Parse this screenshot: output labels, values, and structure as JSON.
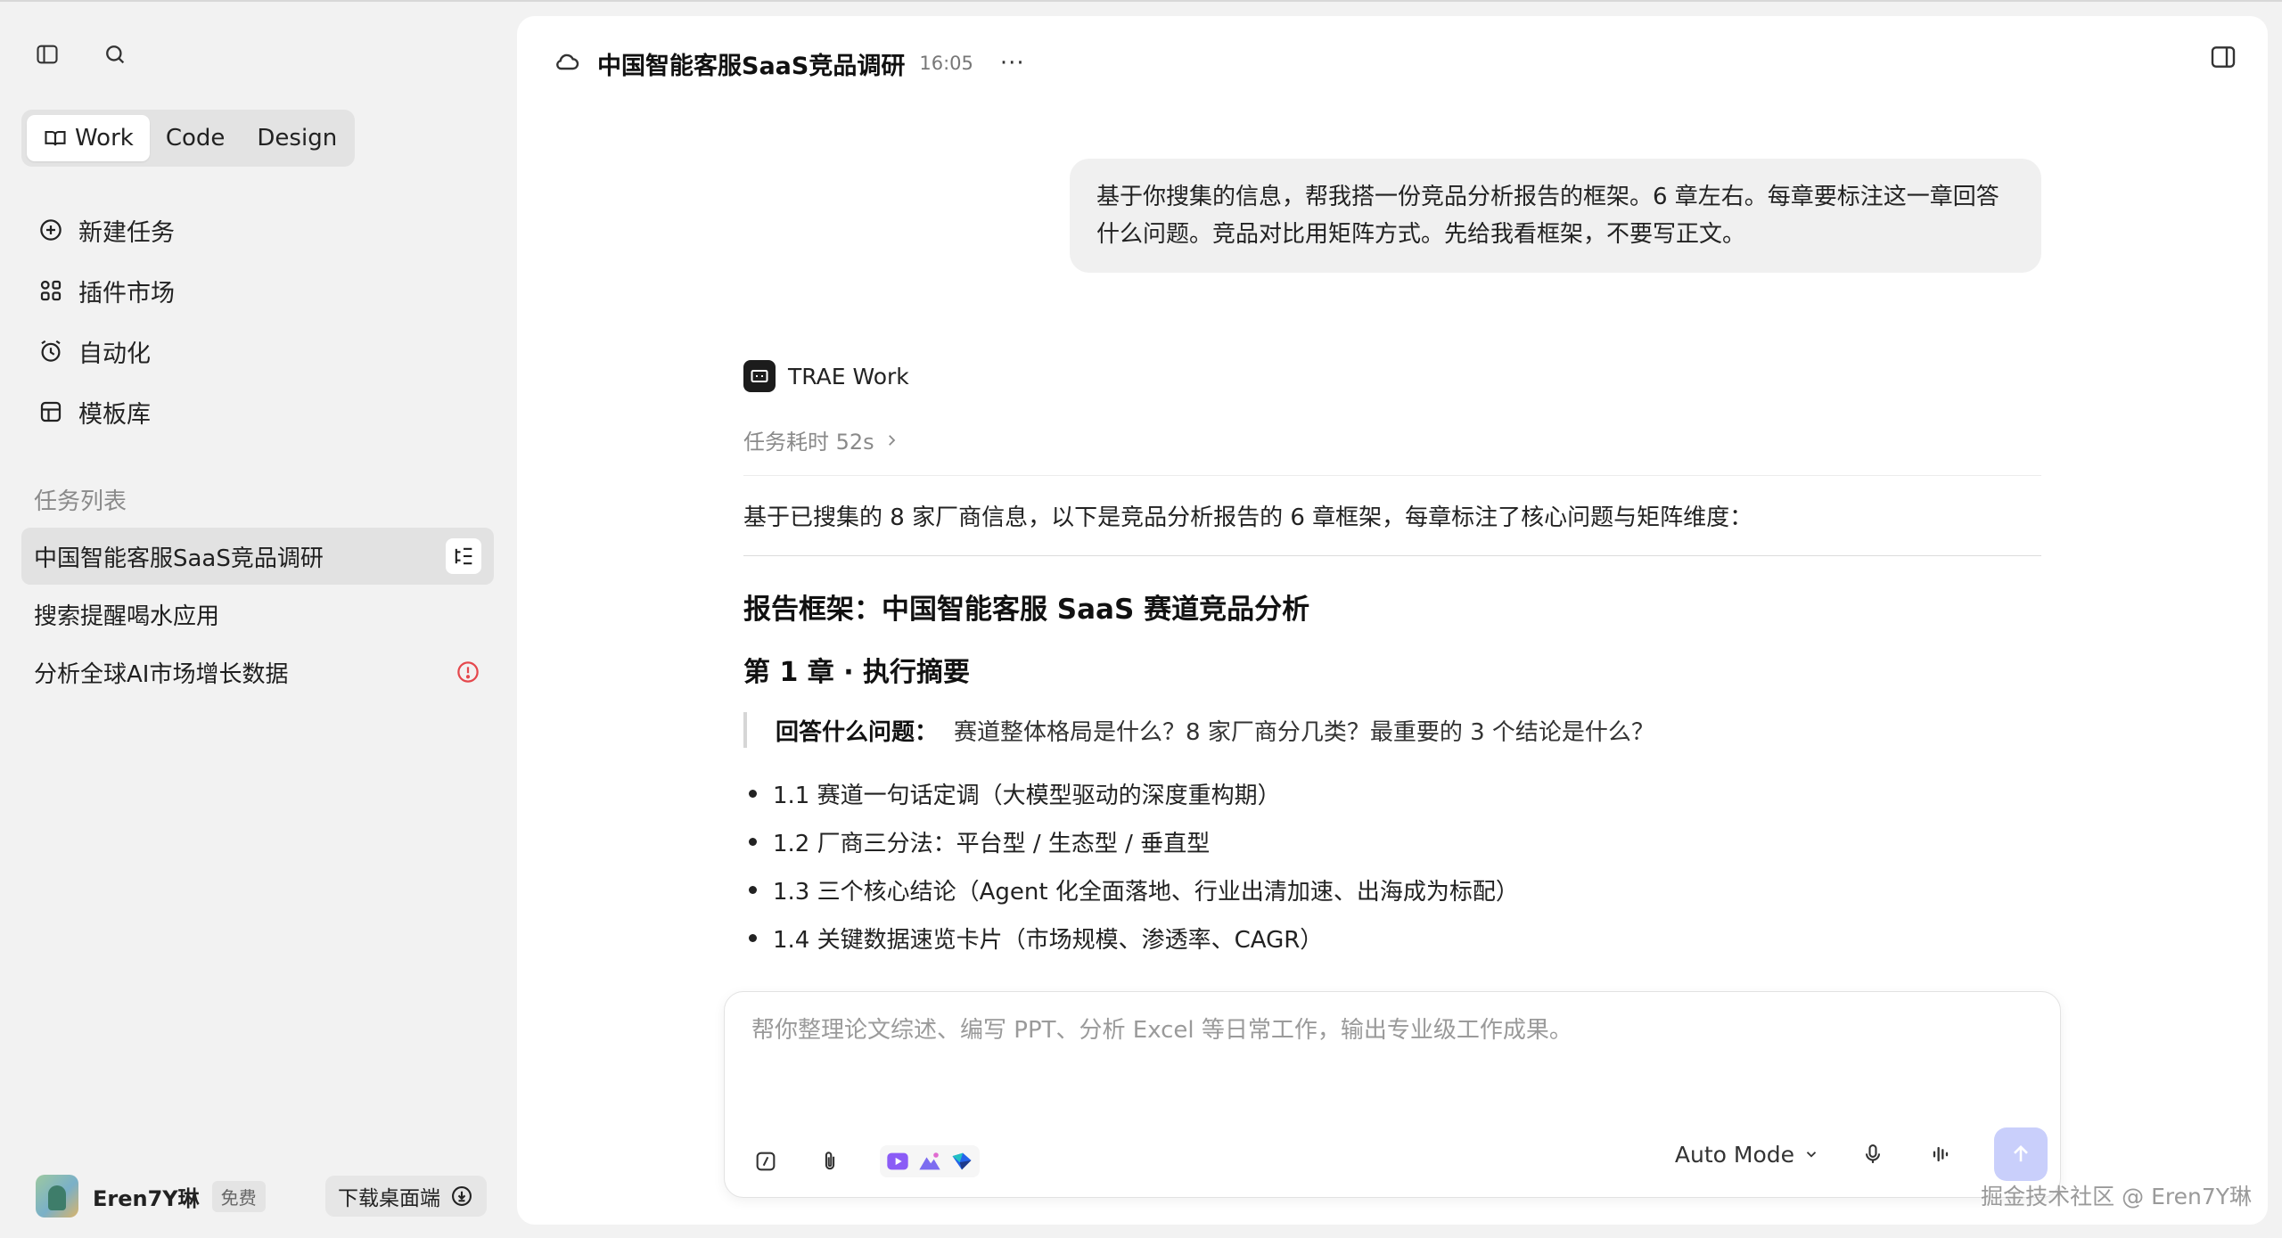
{
  "sidebar": {
    "modes": [
      {
        "label": "Work",
        "active": true
      },
      {
        "label": "Code",
        "active": false
      },
      {
        "label": "Design",
        "active": false
      }
    ],
    "nav": {
      "new_task": "新建任务",
      "plugins": "插件市场",
      "automation": "自动化",
      "templates": "模板库"
    },
    "section_label": "任务列表",
    "tasks": [
      {
        "title": "中国智能客服SaaS竞品调研",
        "active": true
      },
      {
        "title": "搜索提醒喝水应用",
        "active": false
      },
      {
        "title": "分析全球AI市场增长数据",
        "status": "error"
      }
    ],
    "user": {
      "name": "Eren7Y琳",
      "plan": "免费",
      "download_label": "下载桌面端"
    }
  },
  "header": {
    "title": "中国智能客服SaaS竞品调研",
    "time": "16:05",
    "more": "···"
  },
  "conversation": {
    "user_message": "基于你搜集的信息，帮我搭一份竞品分析报告的框架。6 章左右。每章要标注这一章回答什么问题。竞品对比用矩阵方式。先给我看框架，不要写正文。",
    "assistant": {
      "name": "TRAE Work",
      "duration": "任务耗时 52s",
      "intro": "基于已搜集的 8 家厂商信息，以下是竞品分析报告的 6 章框架，每章标注了核心问题与矩阵维度：",
      "report_title": "报告框架：中国智能客服 SaaS 赛道竞品分析",
      "chapter_title": "第 1 章 · 执行摘要",
      "question_label": "回答什么问题：",
      "question_text": "赛道整体格局是什么？8 家厂商分几类？最重要的 3 个结论是什么？",
      "bullets": [
        "1.1 赛道一句话定调（大模型驱动的深度重构期）",
        "1.2 厂商三分法：平台型 / 生态型 / 垂直型",
        "1.3 三个核心结论（Agent 化全面落地、行业出清加速、出海成为标配）",
        "1.4 关键数据速览卡片（市场规模、渗透率、CAGR）"
      ]
    }
  },
  "composer": {
    "placeholder": "帮你整理论文综述、编写 PPT、分析 Excel 等日常工作，输出专业级工作成果。",
    "mode": "Auto Mode"
  },
  "watermark": "掘金技术社区 @ Eren7Y琳",
  "colors": {
    "accent_send": "#c9cffb",
    "error": "#e5484d"
  }
}
